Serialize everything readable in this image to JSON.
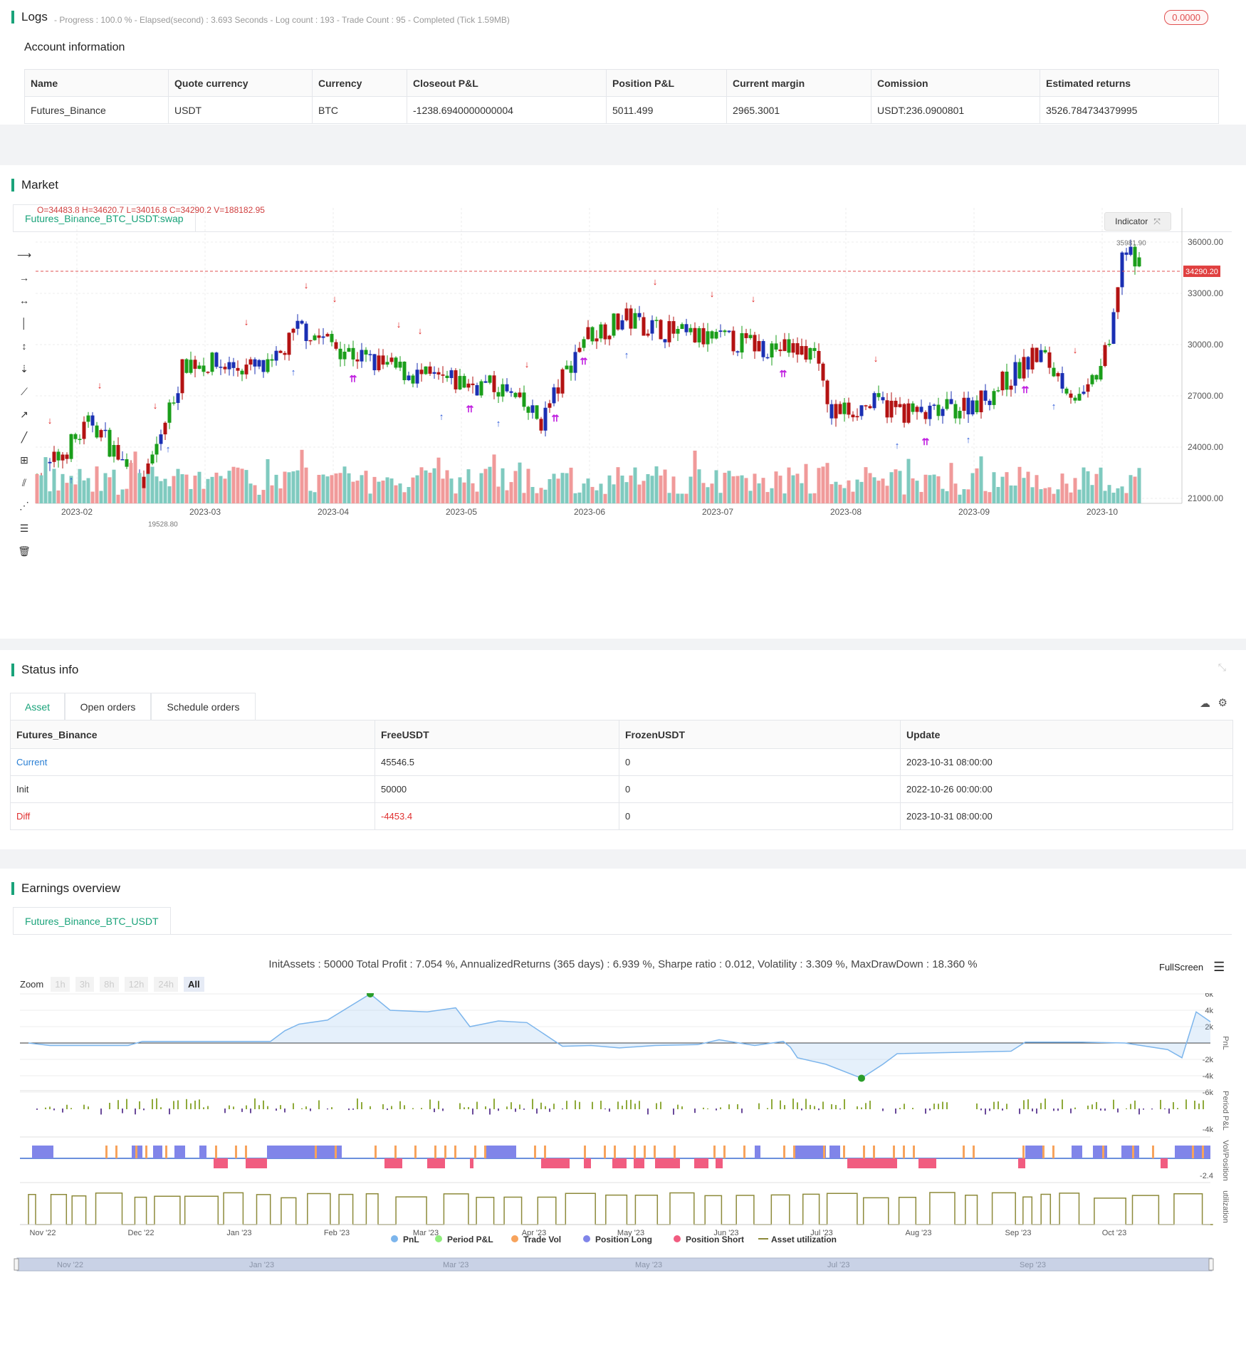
{
  "logs": {
    "title": "Logs",
    "status": "- Progress : 100.0 % - Elapsed(second) : 3.693  Seconds - Log count : 193 - Trade Count : 95 - Completed (Tick 1.59MB)",
    "badge": "0.0000"
  },
  "account": {
    "heading": "Account information",
    "columns": [
      "Name",
      "Quote currency",
      "Currency",
      "Closeout P&L",
      "Position P&L",
      "Current margin",
      "Comission",
      "Estimated returns"
    ],
    "row": [
      "Futures_Binance",
      "USDT",
      "BTC",
      "-1238.6940000000004",
      "5011.499",
      "2965.3001",
      "USDT:236.0900801",
      "3526.784734379995"
    ]
  },
  "market": {
    "title": "Market",
    "tab": "Futures_Binance_BTC_USDT:swap",
    "ohlc": "O=34483.8  H=34620.7  L=34016.8  C=34290.2  V=188182.95",
    "indicator_label": "Indicator",
    "price_ticks": [
      "36000.00",
      "33000.00",
      "30000.00",
      "27000.00",
      "24000.00",
      "21000.00"
    ],
    "current_price": "34290.20",
    "high_label": "35981.90",
    "low_label": "19528.80",
    "x_ticks": [
      "2023-02",
      "2023-03",
      "2023-04",
      "2023-05",
      "2023-06",
      "2023-07",
      "2023-08",
      "2023-09",
      "2023-10"
    ],
    "colors": {
      "up": "#1a9e1a",
      "down": "#b31212",
      "neutral": "#1a2fb3",
      "short": "#e02020",
      "long": "#2b59d9",
      "close": "#c020e0"
    }
  },
  "status": {
    "title": "Status info",
    "tabs": [
      "Asset",
      "Open orders",
      "Schedule orders"
    ],
    "columns": [
      "Futures_Binance",
      "FreeUSDT",
      "FrozenUSDT",
      "Update"
    ],
    "rows": [
      [
        "Current",
        "45546.5",
        "0",
        "2023-10-31 08:00:00"
      ],
      [
        "Init",
        "50000",
        "0",
        "2022-10-26 00:00:00"
      ],
      [
        "Diff",
        "-4453.4",
        "0",
        "2023-10-31 08:00:00"
      ]
    ]
  },
  "earnings": {
    "title": "Earnings overview",
    "tab": "Futures_Binance_BTC_USDT",
    "summary": "InitAssets : 50000 Total Profit : 7.054 %, AnnualizedReturns (365 days) : 6.939 %, Sharpe ratio : 0.012, Volatility : 3.309 %, MaxDrawDown : 18.360 %",
    "fullscreen": "FullScreen",
    "zoom_label": "Zoom",
    "zoom_options": [
      "1h",
      "3h",
      "8h",
      "12h",
      "24h",
      "All"
    ],
    "pnl_ticks": [
      "6k",
      "4k",
      "2k",
      "-2k",
      "-4k",
      "-6k"
    ],
    "period_tick": "-4k",
    "vol_tick": "-2.4",
    "axis_labels": [
      "PnL",
      "Period P&L",
      "Vol/Position",
      "utilization"
    ],
    "x_ticks": [
      "Nov '22",
      "Dec '22",
      "Jan '23",
      "Feb '23",
      "Mar '23",
      "Apr '23",
      "May '23",
      "Jun '23",
      "Jul '23",
      "Aug '23",
      "Sep '23",
      "Oct '23"
    ],
    "legend": [
      {
        "label": "PnL",
        "color": "#7cb5ec"
      },
      {
        "label": "Period P&L",
        "color": "#90ed7d"
      },
      {
        "label": "Trade Vol",
        "color": "#f7a35c"
      },
      {
        "label": "Position Long",
        "color": "#8085e9"
      },
      {
        "label": "Position Short",
        "color": "#f15c80"
      },
      {
        "label": "Asset utilization",
        "color": "#8d8a3a"
      }
    ],
    "navigator_ticks": [
      "Nov '22",
      "Jan '23",
      "Mar '23",
      "May '23",
      "Jul '23",
      "Sep '23"
    ]
  }
}
